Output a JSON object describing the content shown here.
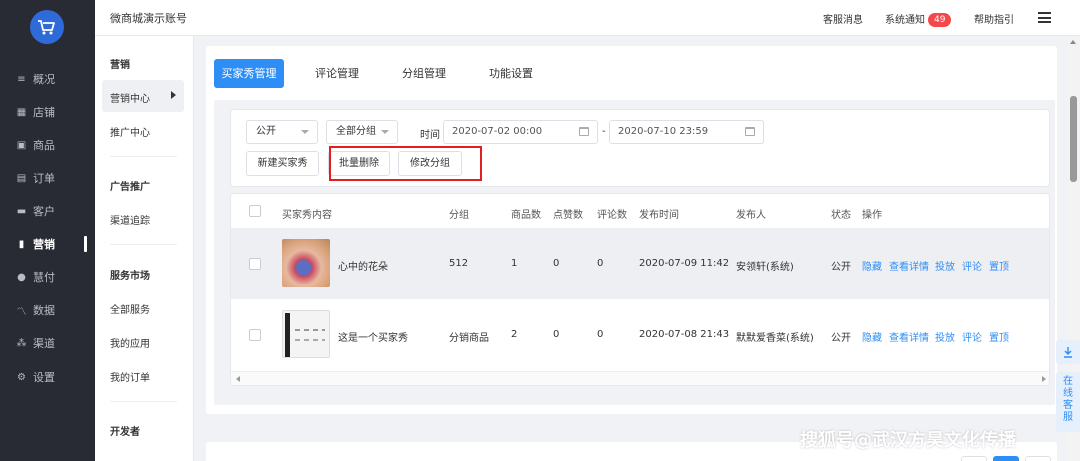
{
  "nav": {
    "items": [
      {
        "label": "概况",
        "icon": "bars-icon"
      },
      {
        "label": "店铺",
        "icon": "store-icon"
      },
      {
        "label": "商品",
        "icon": "product-icon"
      },
      {
        "label": "订单",
        "icon": "order-icon"
      },
      {
        "label": "客户",
        "icon": "customer-icon"
      },
      {
        "label": "营销",
        "icon": "chart-icon",
        "active": true
      },
      {
        "label": "慧付",
        "icon": "pay-icon"
      },
      {
        "label": "数据",
        "icon": "data-icon"
      },
      {
        "label": "渠道",
        "icon": "channel-icon"
      },
      {
        "label": "设置",
        "icon": "gear-icon"
      }
    ]
  },
  "header": {
    "account": "微商城演示账号",
    "service": "客服消息",
    "notice": "系统通知",
    "notice_count": "49",
    "help": "帮助指引"
  },
  "subnav": {
    "section1": "营销",
    "item_active": "营销中心",
    "item_promo": "推广中心",
    "section2": "广告推广",
    "item_channel": "渠道追踪",
    "section3": "服务市场",
    "item_all": "全部服务",
    "item_apps": "我的应用",
    "item_orders": "我的订单",
    "section4": "开发者"
  },
  "tabs": [
    "买家秀管理",
    "评论管理",
    "分组管理",
    "功能设置"
  ],
  "filter": {
    "visibility": "公开",
    "group": "全部分组",
    "time_label": "时间",
    "date_start": "2020-07-02 00:00",
    "sep": "-",
    "date_end": "2020-07-10 23:59",
    "btn_new": "新建买家秀",
    "btn_delete": "批量删除",
    "btn_regroup": "修改分组"
  },
  "table": {
    "headers": [
      "买家秀内容",
      "分组",
      "商品数",
      "点赞数",
      "评论数",
      "发布时间",
      "发布人",
      "状态",
      "操作"
    ],
    "rows": [
      {
        "title": "心中的花朵",
        "group": "512",
        "goods": "1",
        "likes": "0",
        "comments": "0",
        "time": "2020-07-09 11:42",
        "author": "安领轩(系统)",
        "status": "公开",
        "ops": [
          "隐藏",
          "查看详情",
          "投放",
          "评论",
          "置顶"
        ]
      },
      {
        "title": "这是一个买家秀",
        "group": "分销商品",
        "goods": "2",
        "likes": "0",
        "comments": "0",
        "time": "2020-07-08 21:43",
        "author": "默默爱香菜(系统)",
        "status": "公开",
        "ops": [
          "隐藏",
          "查看详情",
          "投放",
          "评论",
          "置顶"
        ]
      }
    ]
  },
  "float": {
    "online_service": "在线客服"
  },
  "watermark": "搜狐号@武汉方昊文化传播",
  "colors": {
    "primary": "#2f8ef6",
    "nav_bg": "#282b33",
    "highlight_box": "#e02020",
    "badge": "#f5484a"
  }
}
